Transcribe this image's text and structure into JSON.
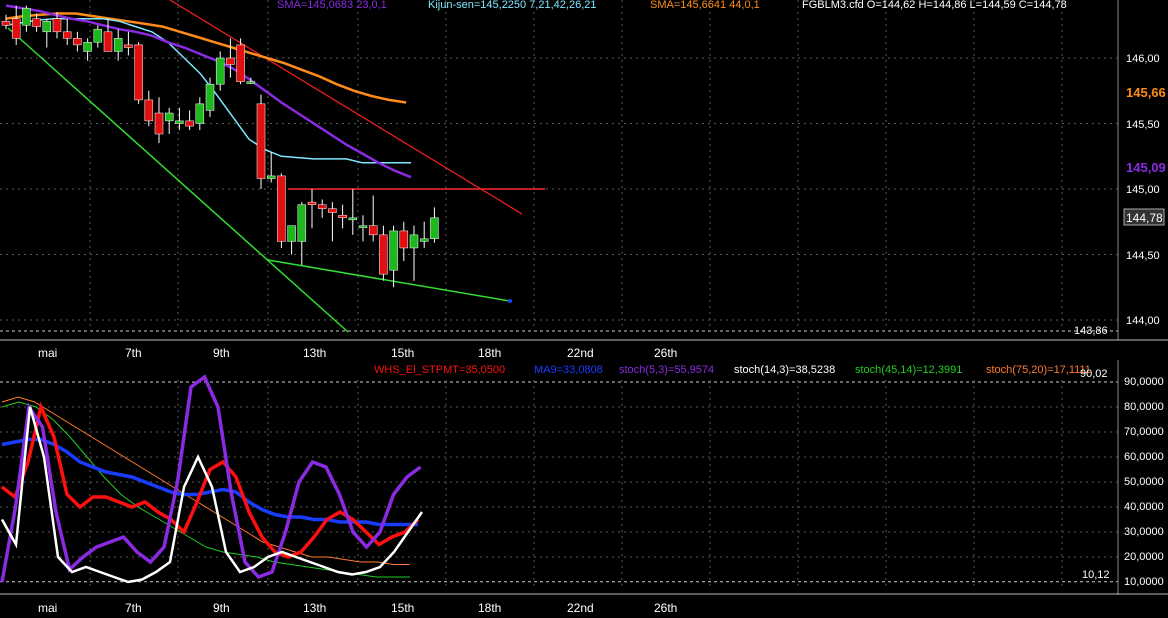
{
  "colors": {
    "background": "#000000",
    "grid": "#5a5a5a",
    "bull_candle": "#1eb81e",
    "bear_candle": "#e01010",
    "sma_short": "#8a2be2",
    "kijun": "#7fe8ff",
    "sma_long": "#ff8c1a",
    "trend_red": "#ff2020",
    "trend_green": "#33dd33",
    "resistance": "#ff2a2a",
    "stpmt": "#ff1010",
    "ma9": "#1a3cff",
    "stoch_5_3": "#8a2be2",
    "stoch_14_3": "#ffffff",
    "stoch_45_14": "#22cc22",
    "stoch_75_20": "#ff7a30",
    "price_label_orange": "#ff8c1a",
    "price_label_purple": "#8a2be2"
  },
  "header": {
    "sma_short": "SMA=145,0683 23,0,1",
    "kijun": "Kijun-sen=145,2250 7,21,42,26,21",
    "sma_long": "SMA=145,6641 44,0,1",
    "ohlc": "FGBLM3.cfd O=144,62 H=144,86 L=144,59 C=144,78"
  },
  "price_axis": {
    "ticks": [
      "146,00",
      "145,50",
      "145,00",
      "144,50",
      "144,00"
    ],
    "label_sma_long": "145,66",
    "label_sma_short": "145,09",
    "label_last": "144,78",
    "label_low": "143,86"
  },
  "x_axis": {
    "labels": [
      "mai",
      "7th",
      "9th",
      "13th",
      "15th",
      "18th",
      "22nd",
      "26th"
    ]
  },
  "indicator": {
    "legend_stpmt": "WHS_El_STPMT=35,0500",
    "legend_ma9": "MA9=33,0808",
    "legend_stoch_5_3": "stoch(5,3)=55,9574",
    "legend_stoch_14_3": "stoch(14,3)=38,5238",
    "legend_stoch_45_14": "stoch(45,14)=12,3991",
    "legend_stoch_75_20": "stoch(75,20)=17,1111",
    "ticks": [
      "90,0000",
      "80,0000",
      "70,0000",
      "60,0000",
      "50,0000",
      "40,0000",
      "30,0000",
      "20,0000",
      "10,0000"
    ],
    "level_high": "90,02",
    "level_low": "10,12"
  },
  "chart_data": [
    {
      "type": "candlestick",
      "title": "FGBLM3.cfd",
      "ylim": [
        143.85,
        146.2
      ],
      "x_labels": [
        "mai",
        "7th",
        "9th",
        "13th",
        "15th",
        "18th",
        "22nd",
        "26th"
      ],
      "candles": [
        {
          "o": 146.28,
          "h": 146.33,
          "l": 146.22,
          "c": 146.25
        },
        {
          "o": 146.3,
          "h": 146.4,
          "l": 146.1,
          "c": 146.15
        },
        {
          "o": 146.25,
          "h": 146.4,
          "l": 146.2,
          "c": 146.38
        },
        {
          "o": 146.3,
          "h": 146.34,
          "l": 146.2,
          "c": 146.24
        },
        {
          "o": 146.2,
          "h": 146.3,
          "l": 146.08,
          "c": 146.28
        },
        {
          "o": 146.3,
          "h": 146.35,
          "l": 146.15,
          "c": 146.2
        },
        {
          "o": 146.2,
          "h": 146.3,
          "l": 146.1,
          "c": 146.15
        },
        {
          "o": 146.15,
          "h": 146.2,
          "l": 146.05,
          "c": 146.1
        },
        {
          "o": 146.05,
          "h": 146.15,
          "l": 145.98,
          "c": 146.12
        },
        {
          "o": 146.12,
          "h": 146.25,
          "l": 146.08,
          "c": 146.22
        },
        {
          "o": 146.2,
          "h": 146.3,
          "l": 146.1,
          "c": 146.05
        },
        {
          "o": 146.05,
          "h": 146.22,
          "l": 145.98,
          "c": 146.15
        },
        {
          "o": 146.1,
          "h": 146.2,
          "l": 146.02,
          "c": 146.08
        },
        {
          "o": 146.1,
          "h": 146.12,
          "l": 145.65,
          "c": 145.68
        },
        {
          "o": 145.68,
          "h": 145.75,
          "l": 145.48,
          "c": 145.52
        },
        {
          "o": 145.58,
          "h": 145.7,
          "l": 145.35,
          "c": 145.42
        },
        {
          "o": 145.52,
          "h": 145.62,
          "l": 145.42,
          "c": 145.58
        },
        {
          "o": 145.5,
          "h": 145.62,
          "l": 145.45,
          "c": 145.52
        },
        {
          "o": 145.52,
          "h": 145.6,
          "l": 145.45,
          "c": 145.48
        },
        {
          "o": 145.5,
          "h": 145.7,
          "l": 145.45,
          "c": 145.65
        },
        {
          "o": 145.6,
          "h": 145.85,
          "l": 145.55,
          "c": 145.8
        },
        {
          "o": 145.8,
          "h": 146.05,
          "l": 145.75,
          "c": 146.0
        },
        {
          "o": 146.0,
          "h": 146.15,
          "l": 145.85,
          "c": 145.95
        },
        {
          "o": 146.1,
          "h": 146.15,
          "l": 145.8,
          "c": 145.82
        },
        {
          "o": 145.82,
          "h": 145.85,
          "l": 145.8,
          "c": 145.82
        },
        {
          "o": 145.65,
          "h": 145.72,
          "l": 145.0,
          "c": 145.08
        },
        {
          "o": 145.08,
          "h": 145.28,
          "l": 145.05,
          "c": 145.1
        },
        {
          "o": 145.1,
          "h": 145.12,
          "l": 144.55,
          "c": 144.6
        },
        {
          "o": 144.6,
          "h": 144.7,
          "l": 144.5,
          "c": 144.72
        },
        {
          "o": 144.6,
          "h": 144.9,
          "l": 144.42,
          "c": 144.88
        },
        {
          "o": 144.9,
          "h": 145.0,
          "l": 144.7,
          "c": 144.88
        },
        {
          "o": 144.88,
          "h": 144.92,
          "l": 144.78,
          "c": 144.85
        },
        {
          "o": 144.85,
          "h": 144.9,
          "l": 144.6,
          "c": 144.82
        },
        {
          "o": 144.8,
          "h": 144.88,
          "l": 144.7,
          "c": 144.78
        },
        {
          "o": 144.78,
          "h": 145.0,
          "l": 144.65,
          "c": 144.78
        },
        {
          "o": 144.72,
          "h": 144.8,
          "l": 144.6,
          "c": 144.72
        },
        {
          "o": 144.72,
          "h": 144.95,
          "l": 144.6,
          "c": 144.65
        },
        {
          "o": 144.65,
          "h": 144.72,
          "l": 144.3,
          "c": 144.35
        },
        {
          "o": 144.38,
          "h": 144.72,
          "l": 144.25,
          "c": 144.68
        },
        {
          "o": 144.68,
          "h": 144.75,
          "l": 144.45,
          "c": 144.55
        },
        {
          "o": 144.55,
          "h": 144.72,
          "l": 144.3,
          "c": 144.65
        },
        {
          "o": 144.6,
          "h": 144.75,
          "l": 144.55,
          "c": 144.62
        },
        {
          "o": 144.62,
          "h": 144.86,
          "l": 144.59,
          "c": 144.78
        }
      ],
      "overlays": {
        "sma_short": [
          146.4,
          146.38,
          146.36,
          146.33,
          146.3,
          146.28,
          146.25,
          146.22,
          146.2,
          146.17,
          146.12,
          146.08,
          146.03,
          145.98,
          145.92,
          145.84,
          145.75,
          145.66,
          145.58,
          145.5,
          145.42,
          145.34,
          145.27,
          145.2,
          145.14,
          145.09
        ],
        "kijun": [
          146.25,
          146.27,
          146.29,
          146.3,
          146.3,
          146.3,
          146.3,
          146.28,
          146.24,
          146.2,
          146.12,
          146.0,
          145.88,
          145.72,
          145.55,
          145.38,
          145.3,
          145.25,
          145.24,
          145.23,
          145.23,
          145.23,
          145.2,
          145.2,
          145.2,
          145.2
        ],
        "sma_long": [
          146.3,
          146.32,
          146.33,
          146.34,
          146.34,
          146.32,
          146.3,
          146.28,
          146.26,
          146.24,
          146.2,
          146.16,
          146.12,
          146.08,
          146.04,
          146.0,
          145.96,
          145.91,
          145.86,
          145.8,
          145.75,
          145.71,
          145.68,
          145.66
        ],
        "resistance_level": 145.0
      }
    },
    {
      "type": "line",
      "title": "",
      "ylim": [
        5,
        95
      ],
      "series": [
        {
          "name": "WHS_El_STPMT",
          "values": [
            48,
            44,
            58,
            80,
            68,
            45,
            40,
            44,
            44,
            42,
            40,
            42,
            38,
            35,
            30,
            42,
            55,
            58,
            52,
            38,
            28,
            22,
            20,
            22,
            28,
            35,
            38,
            35,
            30,
            25,
            28,
            30,
            35
          ]
        },
        {
          "name": "MA9",
          "values": [
            65,
            66,
            67,
            67,
            65,
            62,
            58,
            56,
            54,
            53,
            52,
            50,
            48,
            46,
            45,
            45,
            46,
            47,
            46,
            42,
            39,
            37,
            36,
            36,
            35,
            35,
            34,
            34,
            34,
            33,
            33,
            33,
            33
          ]
        },
        {
          "name": "stoch(5,3)",
          "values": [
            10,
            40,
            80,
            72,
            38,
            15,
            20,
            24,
            26,
            28,
            22,
            18,
            24,
            50,
            88,
            92,
            80,
            45,
            18,
            12,
            14,
            30,
            50,
            58,
            56,
            45,
            30,
            24,
            30,
            45,
            52,
            56
          ]
        },
        {
          "name": "stoch(14,3)",
          "values": [
            35,
            25,
            80,
            60,
            20,
            14,
            16,
            14,
            12,
            10,
            11,
            14,
            18,
            48,
            60,
            48,
            22,
            14,
            16,
            20,
            22,
            20,
            18,
            16,
            14,
            13,
            14,
            16,
            22,
            30,
            38
          ]
        }
      ],
      "levels": [
        90.02,
        10.12
      ]
    }
  ]
}
